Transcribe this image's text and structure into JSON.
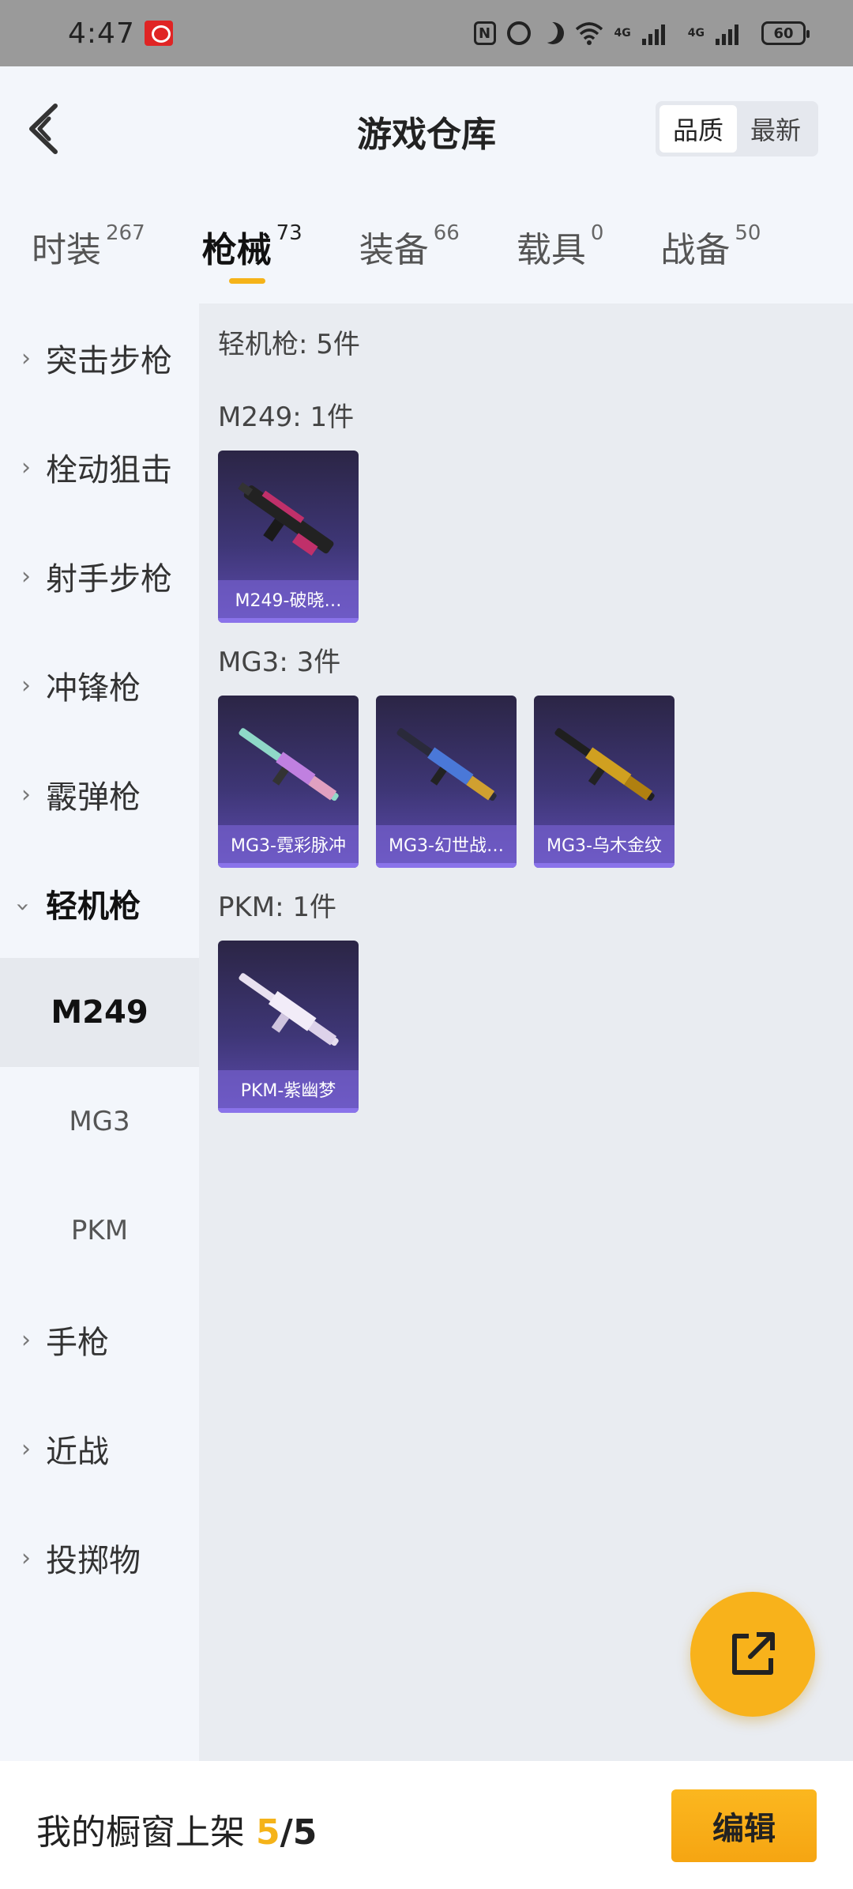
{
  "status_bar": {
    "time": "4:47",
    "net1": "4G",
    "net2": "4G",
    "battery": "60",
    "nfc": "N"
  },
  "header": {
    "title": "游戏仓库",
    "sort_options": [
      "品质",
      "最新"
    ],
    "active_sort": "品质"
  },
  "tabs": [
    {
      "label": "时装",
      "count": "267"
    },
    {
      "label": "枪械",
      "count": "73",
      "active": true
    },
    {
      "label": "装备",
      "count": "66"
    },
    {
      "label": "载具",
      "count": "0"
    },
    {
      "label": "战备",
      "count": "50"
    }
  ],
  "sidebar": {
    "categories": [
      "突击步枪",
      "栓动狙击",
      "射手步枪",
      "冲锋枪",
      "霰弹枪",
      "轻机枪",
      "手枪",
      "近战",
      "投掷物"
    ],
    "expanded": "轻机枪",
    "subitems": [
      "M249",
      "MG3",
      "PKM"
    ],
    "active_sub": "M249"
  },
  "content": {
    "category_title": "轻机枪: 5件",
    "groups": [
      {
        "title": "M249: 1件",
        "items": [
          {
            "name": "M249-破晓…",
            "accent": "#c0306a"
          }
        ]
      },
      {
        "title": "MG3: 3件",
        "items": [
          {
            "name": "MG3-霓彩脉冲",
            "accent": "#7ad0c0"
          },
          {
            "name": "MG3-幻世战…",
            "accent": "#4a78d8"
          },
          {
            "name": "MG3-乌木金纹",
            "accent": "#d0a020"
          }
        ]
      },
      {
        "title": "PKM: 1件",
        "items": [
          {
            "name": "PKM-紫幽梦",
            "accent": "#e6dcf2"
          }
        ]
      }
    ]
  },
  "bottom_bar": {
    "label": "我的橱窗上架 ",
    "count": "5",
    "separator": "/",
    "total": "5",
    "edit_label": "编辑"
  },
  "colors": {
    "accent": "#f5b319",
    "card_purple": "#5e4cb0"
  }
}
